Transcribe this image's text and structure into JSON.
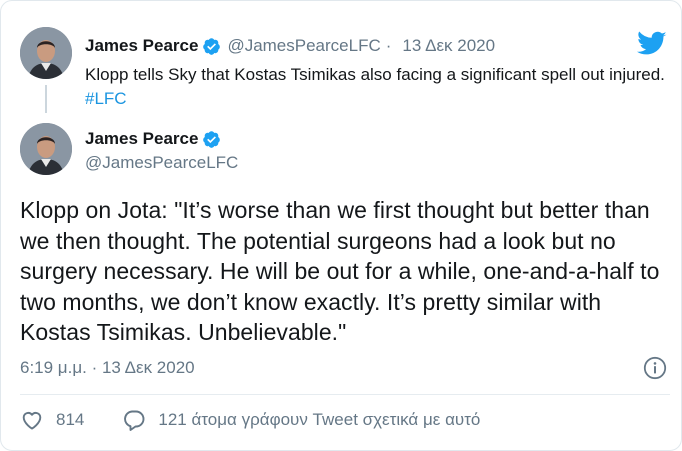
{
  "parent_tweet": {
    "author_name": "James Pearce",
    "author_handle": "@JamesPearceLFC",
    "separator": "·",
    "date": "13 Δεκ 2020",
    "text": "Klopp tells Sky that Kostas Tsimikas also facing a significant spell out injured.",
    "hashtag": "#LFC"
  },
  "main_tweet": {
    "author_name": "James Pearce",
    "author_handle": "@JamesPearceLFC",
    "text": "Klopp on Jota: \"It’s worse than we first thought but better than we then thought. The potential surgeons had a look but no surgery necessary. He will be out for a while, one-and-a-half to two months, we don’t know exactly. It’s pretty similar with Kostas Tsimikas. Unbelievable.\"",
    "timestamp": "6:19 μ.μ. · 13 Δεκ 2020"
  },
  "actions": {
    "like_count": "814",
    "reply_label": "121 άτομα γράφουν Tweet σχετικά με αυτό"
  },
  "colors": {
    "accent": "#1da1f2",
    "hashtag": "#1b95e0",
    "muted": "#657786",
    "text": "#14171a"
  },
  "icons": [
    "twitter-bird-icon",
    "verified-badge-icon",
    "info-icon",
    "heart-icon",
    "reply-icon"
  ]
}
